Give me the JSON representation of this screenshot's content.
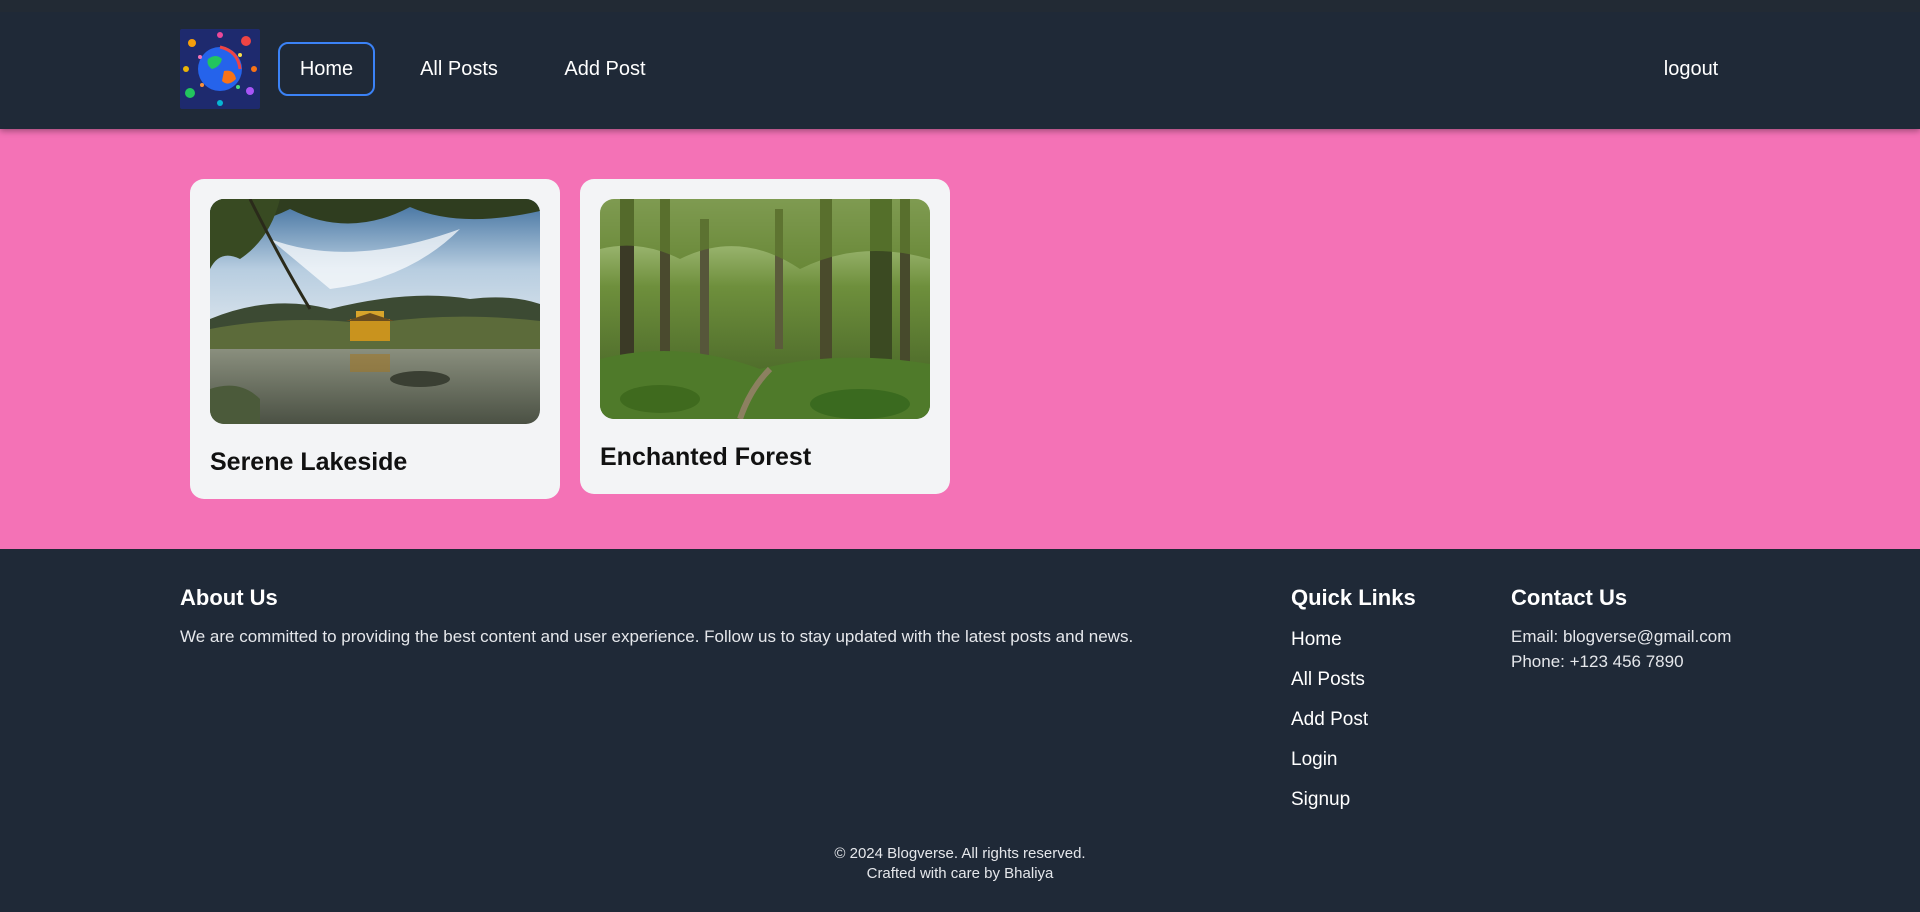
{
  "header": {
    "nav": {
      "home": "Home",
      "all_posts": "All Posts",
      "add_post": "Add Post",
      "logout": "logout"
    }
  },
  "posts": [
    {
      "title": "Serene Lakeside"
    },
    {
      "title": "Enchanted Forest"
    }
  ],
  "footer": {
    "about": {
      "heading": "About Us",
      "text": "We are committed to providing the best content and user experience. Follow us to stay updated with the latest posts and news."
    },
    "quick_links": {
      "heading": "Quick Links",
      "items": [
        "Home",
        "All Posts",
        "Add Post",
        "Login",
        "Signup"
      ]
    },
    "contact": {
      "heading": "Contact Us",
      "email": "Email: blogverse@gmail.com",
      "phone": "Phone: +123 456 7890"
    },
    "copyright": "© 2024 Blogverse. All rights reserved.",
    "credit": "Crafted with care by Bhaliya"
  },
  "colors": {
    "header_bg": "#1f2937",
    "main_bg": "#f472b6",
    "card_bg": "#f3f4f6",
    "active_border": "#3b82f6"
  }
}
